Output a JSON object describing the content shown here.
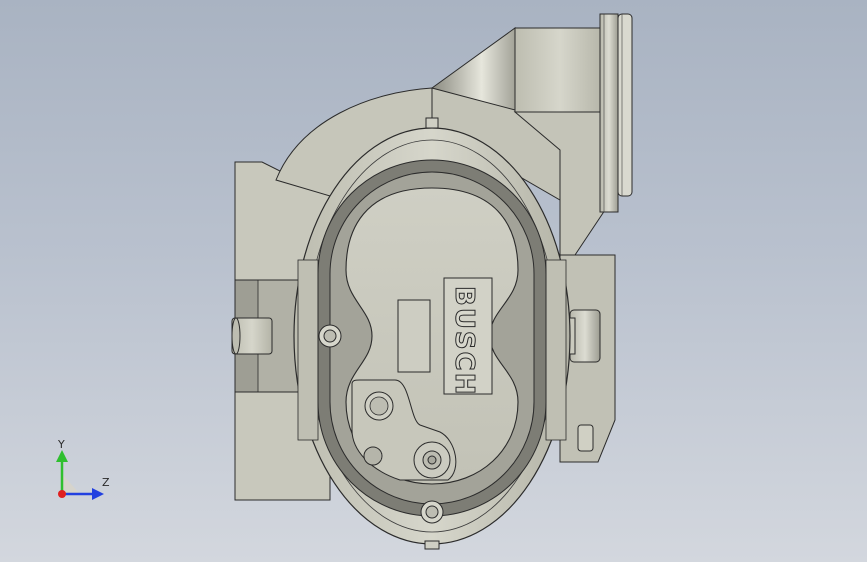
{
  "viewport": {
    "background_top": "#a9b3c2",
    "background_bottom": "#d3d7de"
  },
  "model": {
    "body_color": "#c9c9bd",
    "shadow_color": "#8f8f85",
    "edge_color": "#2b2b2b",
    "logo_text": "BUSCH"
  },
  "triad": {
    "y_label": "Y",
    "z_label": "Z",
    "y_axis_color": "#2fbf2f",
    "z_axis_color": "#2240e0",
    "x_axis_color": "#e02020"
  }
}
